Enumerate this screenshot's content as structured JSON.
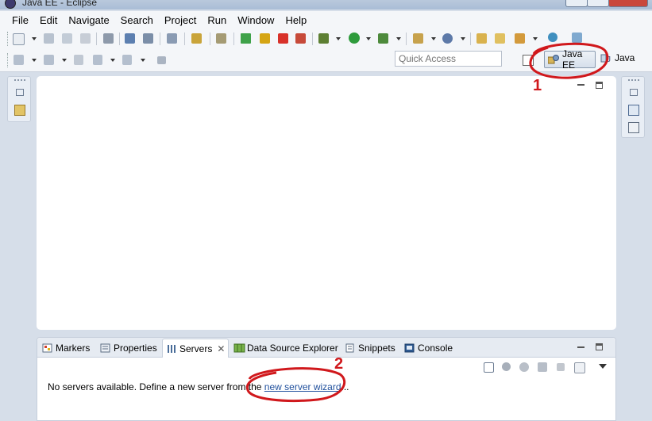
{
  "window": {
    "title": "Java EE - Eclipse"
  },
  "menu": [
    "File",
    "Edit",
    "Navigate",
    "Search",
    "Project",
    "Run",
    "Window",
    "Help"
  ],
  "toolbar": {
    "quick_access_placeholder": "Quick Access",
    "perspectives": [
      {
        "label": "Java EE",
        "active": true
      },
      {
        "label": "Java",
        "active": false
      }
    ]
  },
  "views": {
    "tabs": [
      {
        "label": "Markers",
        "icon": "markers-icon",
        "active": false
      },
      {
        "label": "Properties",
        "icon": "properties-icon",
        "active": false
      },
      {
        "label": "Servers",
        "icon": "servers-icon",
        "active": true
      },
      {
        "label": "Data Source Explorer",
        "icon": "data-source-explorer-icon",
        "active": false
      },
      {
        "label": "Snippets",
        "icon": "snippets-icon",
        "active": false
      },
      {
        "label": "Console",
        "icon": "console-icon",
        "active": false
      }
    ],
    "servers_message": "No servers available. Define a new server from the ",
    "servers_link": "new server wizard",
    "servers_suffix": "..."
  },
  "annotations": [
    "1",
    "2"
  ],
  "colors": {
    "annotation": "#d0181c",
    "link": "#1f4f9c",
    "background": "#d6dee9"
  }
}
